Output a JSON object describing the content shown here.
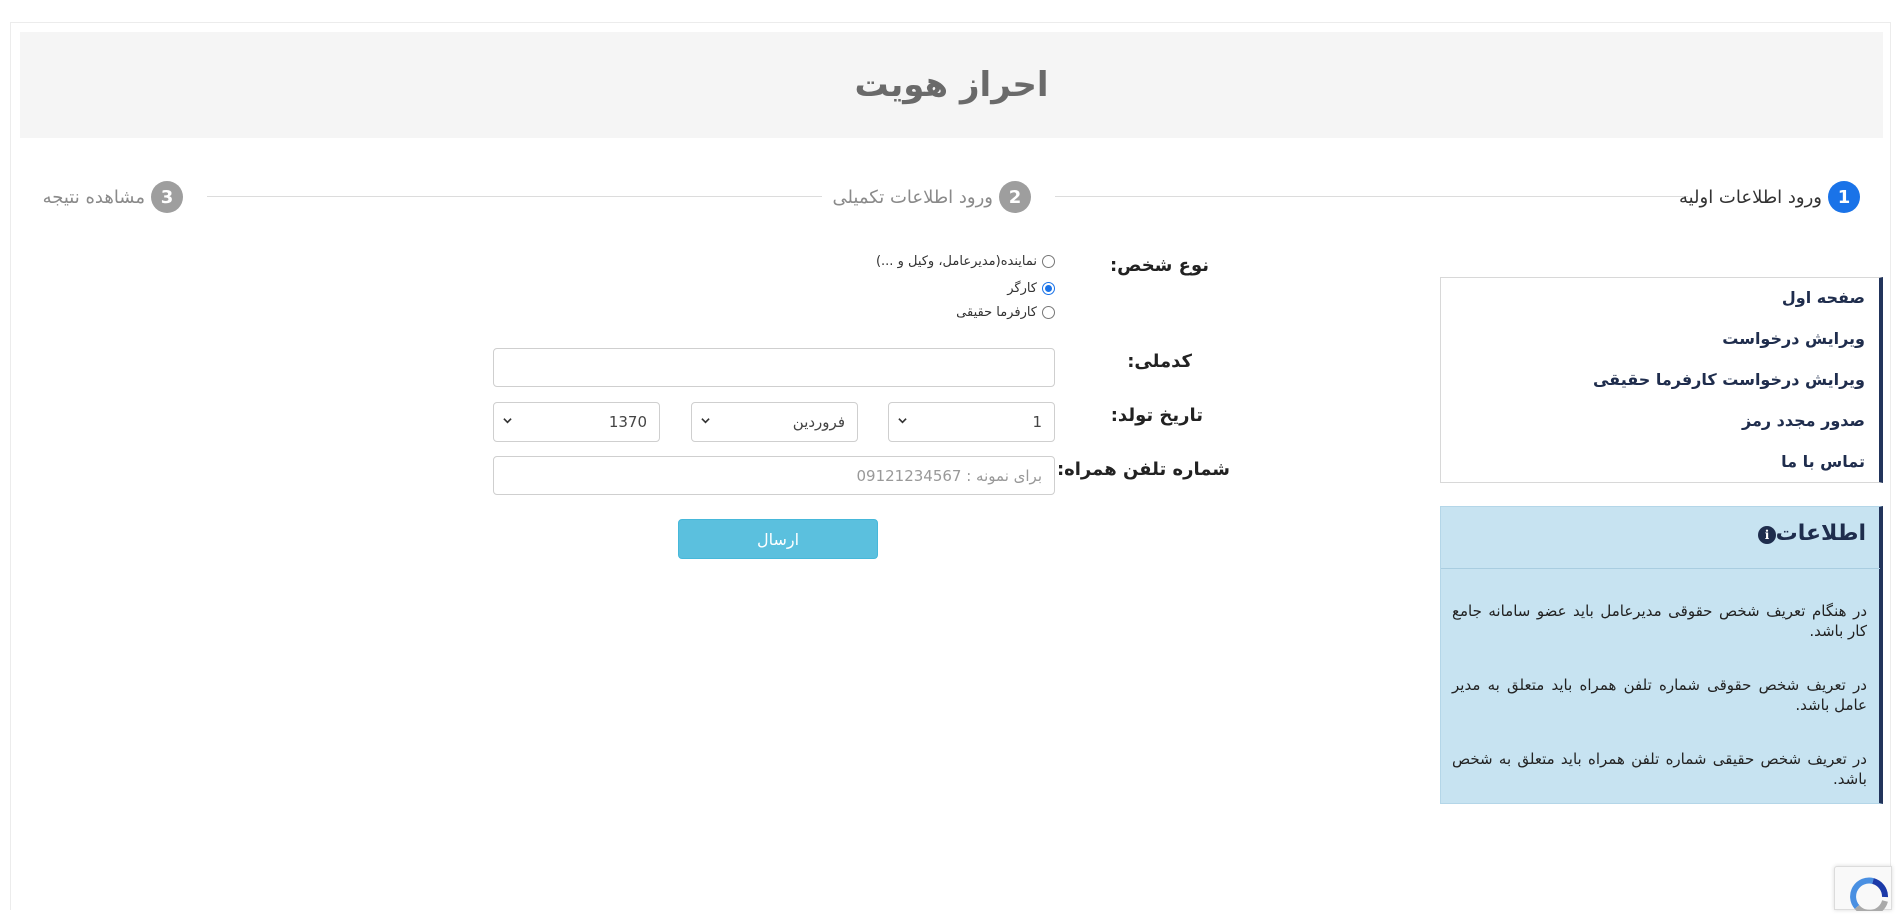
{
  "page": {
    "title": "احراز هویت"
  },
  "steps": [
    {
      "number": "1",
      "label": "ورود اطلاعات اولیه",
      "state": "active"
    },
    {
      "number": "2",
      "label": "ورود اطلاعات تکمیلی",
      "state": "pending"
    },
    {
      "number": "3",
      "label": "مشاهده نتیجه",
      "state": "pending"
    }
  ],
  "colors": {
    "step_active": "#1a73e8",
    "step_pending": "#9e9e9e",
    "brand_border": "#22345b",
    "submit": "#5bc0de",
    "info_bg": "#c7e3f1"
  },
  "form": {
    "person_type_label": "نوع شخص:",
    "person_type_options": [
      {
        "label": "نماینده(مدیرعامل، وکیل و ...)",
        "checked": false
      },
      {
        "label": "کارگر",
        "checked": true
      },
      {
        "label": "کارفرما حقیقی",
        "checked": false
      }
    ],
    "national_code_label": "کدملی:",
    "national_code_value": "",
    "birth_date_label": "تاریخ تولد:",
    "birth_day": "1",
    "birth_month": "فروردین",
    "birth_year": "1370",
    "phone_label": "شماره تلفن همراه:",
    "phone_placeholder": "برای نمونه : 09121234567",
    "submit_label": "ارسال"
  },
  "sidebar": {
    "items": [
      {
        "label": "صفحه اول"
      },
      {
        "label": "ویرایش درخواست"
      },
      {
        "label": "ویرایش درخواست کارفرما حقیقی"
      },
      {
        "label": "صدور مجدد رمز"
      },
      {
        "label": "تماس با ما"
      }
    ]
  },
  "info": {
    "title": "اطلاعات",
    "icon": "info-circle-icon",
    "paragraphs": [
      "در هنگام تعریف شخص حقوقی مدیرعامل باید عضو سامانه جامع کار باشد.",
      "در تعریف شخص حقوقی شماره تلفن همراه باید متعلق به مدیر عامل باشد.",
      "در تعریف شخص حقیقی شماره تلفن همراه باید متعلق به شخص باشد."
    ]
  }
}
